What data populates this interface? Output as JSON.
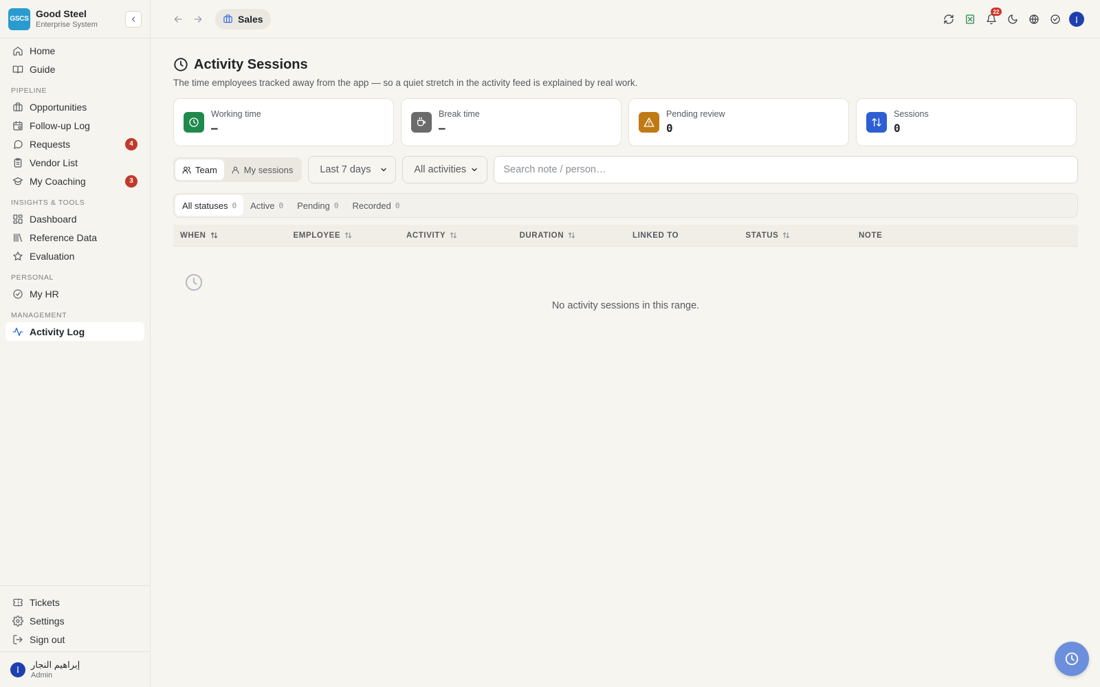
{
  "brand": {
    "logo_text": "GSCS",
    "name": "Good Steel",
    "subtitle": "Enterprise System"
  },
  "sidebar": {
    "top_items": [
      {
        "label": "Home",
        "icon": "home-icon"
      },
      {
        "label": "Guide",
        "icon": "book-icon"
      }
    ],
    "sections": [
      {
        "label": "PIPELINE",
        "items": [
          {
            "label": "Opportunities",
            "icon": "briefcase-icon"
          },
          {
            "label": "Follow-up Log",
            "icon": "calendar-icon"
          },
          {
            "label": "Requests",
            "icon": "chat-icon",
            "badge": "4"
          },
          {
            "label": "Vendor List",
            "icon": "clipboard-icon"
          },
          {
            "label": "My Coaching",
            "icon": "graduation-icon",
            "badge": "3"
          }
        ]
      },
      {
        "label": "INSIGHTS & TOOLS",
        "items": [
          {
            "label": "Dashboard",
            "icon": "grid-icon"
          },
          {
            "label": "Reference Data",
            "icon": "library-icon"
          },
          {
            "label": "Evaluation",
            "icon": "star-icon"
          }
        ]
      },
      {
        "label": "PERSONAL",
        "items": [
          {
            "label": "My HR",
            "icon": "check-circle-icon"
          }
        ]
      },
      {
        "label": "MANAGEMENT",
        "items": [
          {
            "label": "Activity Log",
            "icon": "activity-icon",
            "active": true
          }
        ]
      }
    ],
    "bottom_items": [
      {
        "label": "Tickets",
        "icon": "ticket-icon"
      },
      {
        "label": "Settings",
        "icon": "gear-icon"
      },
      {
        "label": "Sign out",
        "icon": "logout-icon"
      }
    ],
    "user": {
      "initials": "إ",
      "name": "إبراهيم النجار",
      "role": "Admin"
    }
  },
  "topbar": {
    "breadcrumb": "Sales",
    "notification_count": "22",
    "avatar_initials": "إ"
  },
  "page": {
    "title": "Activity Sessions",
    "subtitle": "The time employees tracked away from the app — so a quiet stretch in the activity feed is explained by real work."
  },
  "stats": [
    {
      "label": "Working time",
      "value": "—",
      "color": "#1f8a4c",
      "icon": "clock-icon"
    },
    {
      "label": "Break time",
      "value": "—",
      "color": "#6b6b6b",
      "icon": "coffee-icon"
    },
    {
      "label": "Pending review",
      "value": "0",
      "color": "#c07a14",
      "icon": "warning-icon"
    },
    {
      "label": "Sessions",
      "value": "0",
      "color": "#2d5fd3",
      "icon": "arrows-icon"
    }
  ],
  "filters": {
    "scope_team": "Team",
    "scope_mine": "My sessions",
    "range_value": "Last 7 days",
    "activity_value": "All activities",
    "search_placeholder": "Search note / person…"
  },
  "status_tabs": [
    {
      "label": "All statuses",
      "count": "0"
    },
    {
      "label": "Active",
      "count": "0"
    },
    {
      "label": "Pending",
      "count": "0"
    },
    {
      "label": "Recorded",
      "count": "0"
    }
  ],
  "table": {
    "columns": [
      "WHEN",
      "EMPLOYEE",
      "ACTIVITY",
      "DURATION",
      "LINKED TO",
      "STATUS",
      "NOTE"
    ],
    "empty_text": "No activity sessions in this range."
  },
  "colors": {
    "accent": "#2563eb",
    "badge": "#c0392b",
    "fab": "#6b8fdc"
  }
}
